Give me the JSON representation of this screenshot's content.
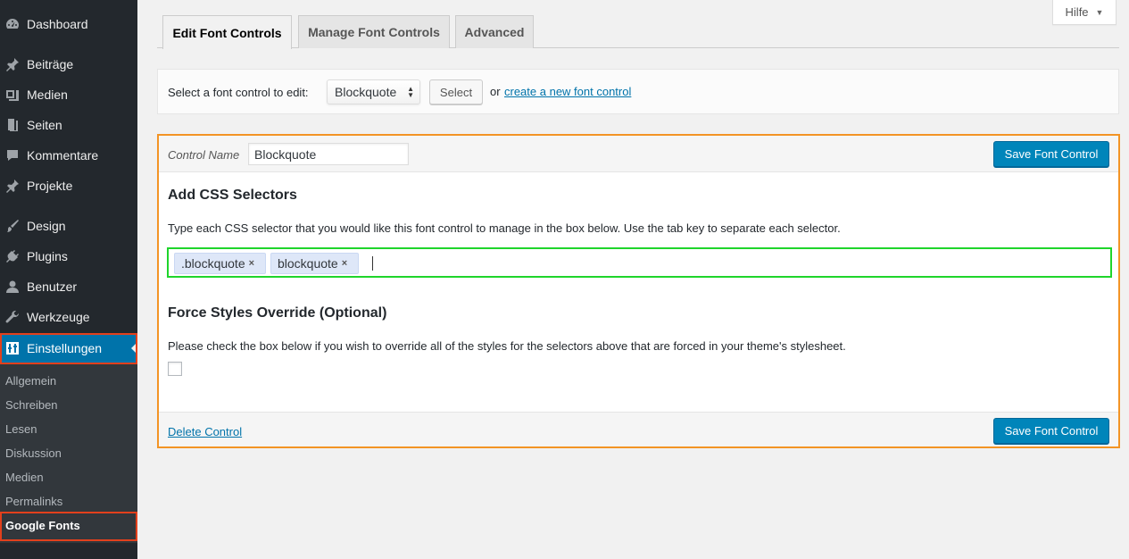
{
  "sidebar": {
    "items": [
      {
        "label": "Dashboard",
        "icon": "dashboard-icon"
      },
      {
        "label": "Beiträge",
        "icon": "pin-icon"
      },
      {
        "label": "Medien",
        "icon": "media-icon"
      },
      {
        "label": "Seiten",
        "icon": "page-icon"
      },
      {
        "label": "Kommentare",
        "icon": "comment-icon"
      },
      {
        "label": "Projekte",
        "icon": "pin-icon"
      },
      {
        "label": "Design",
        "icon": "brush-icon"
      },
      {
        "label": "Plugins",
        "icon": "plugin-icon"
      },
      {
        "label": "Benutzer",
        "icon": "user-icon"
      },
      {
        "label": "Werkzeuge",
        "icon": "wrench-icon"
      },
      {
        "label": "Einstellungen",
        "icon": "settings-icon",
        "active": true
      }
    ],
    "submenu": [
      {
        "label": "Allgemein"
      },
      {
        "label": "Schreiben"
      },
      {
        "label": "Lesen"
      },
      {
        "label": "Diskussion"
      },
      {
        "label": "Medien"
      },
      {
        "label": "Permalinks"
      },
      {
        "label": "Google Fonts",
        "current": true
      }
    ]
  },
  "help": {
    "label": "Hilfe"
  },
  "tabs": [
    {
      "label": "Edit Font Controls",
      "active": true
    },
    {
      "label": "Manage Font Controls"
    },
    {
      "label": "Advanced"
    }
  ],
  "select_bar": {
    "label": "Select a font control to edit:",
    "selected": "Blockquote",
    "button": "Select",
    "or_text": "or",
    "create_link": "create a new font control"
  },
  "editor": {
    "control_name_label": "Control Name",
    "control_name_value": "Blockquote",
    "save_label": "Save Font Control",
    "css_heading": "Add CSS Selectors",
    "css_description": "Type each CSS selector that you would like this font control to manage in the box below. Use the tab key to separate each selector.",
    "selectors": [
      ".blockquote",
      "blockquote"
    ],
    "tag_remove_glyph": "×",
    "force_heading": "Force Styles Override (Optional)",
    "force_description": "Please check the box below if you wish to override all of the styles for the selectors above that are forced in your theme's stylesheet.",
    "force_checked": false,
    "delete_label": "Delete Control"
  },
  "colors": {
    "sidebar_bg": "#23282d",
    "active_blue": "#0073aa",
    "button_blue": "#0085ba",
    "highlight_orange": "#f39425",
    "highlight_green": "#1fd52b",
    "highlight_red": "#e2401c"
  }
}
